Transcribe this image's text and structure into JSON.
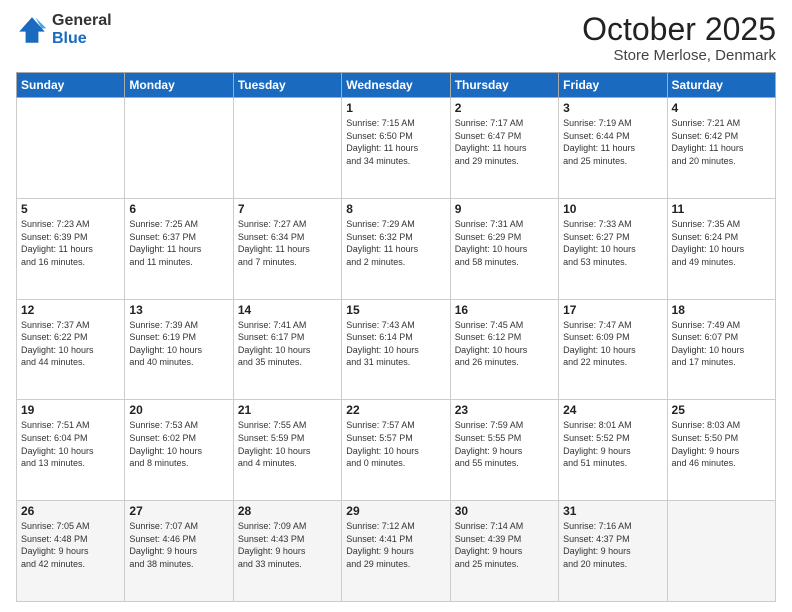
{
  "logo": {
    "general": "General",
    "blue": "Blue"
  },
  "header": {
    "month": "October 2025",
    "location": "Store Merlose, Denmark"
  },
  "weekdays": [
    "Sunday",
    "Monday",
    "Tuesday",
    "Wednesday",
    "Thursday",
    "Friday",
    "Saturday"
  ],
  "weeks": [
    [
      {
        "day": "",
        "info": ""
      },
      {
        "day": "",
        "info": ""
      },
      {
        "day": "",
        "info": ""
      },
      {
        "day": "1",
        "info": "Sunrise: 7:15 AM\nSunset: 6:50 PM\nDaylight: 11 hours\nand 34 minutes."
      },
      {
        "day": "2",
        "info": "Sunrise: 7:17 AM\nSunset: 6:47 PM\nDaylight: 11 hours\nand 29 minutes."
      },
      {
        "day": "3",
        "info": "Sunrise: 7:19 AM\nSunset: 6:44 PM\nDaylight: 11 hours\nand 25 minutes."
      },
      {
        "day": "4",
        "info": "Sunrise: 7:21 AM\nSunset: 6:42 PM\nDaylight: 11 hours\nand 20 minutes."
      }
    ],
    [
      {
        "day": "5",
        "info": "Sunrise: 7:23 AM\nSunset: 6:39 PM\nDaylight: 11 hours\nand 16 minutes."
      },
      {
        "day": "6",
        "info": "Sunrise: 7:25 AM\nSunset: 6:37 PM\nDaylight: 11 hours\nand 11 minutes."
      },
      {
        "day": "7",
        "info": "Sunrise: 7:27 AM\nSunset: 6:34 PM\nDaylight: 11 hours\nand 7 minutes."
      },
      {
        "day": "8",
        "info": "Sunrise: 7:29 AM\nSunset: 6:32 PM\nDaylight: 11 hours\nand 2 minutes."
      },
      {
        "day": "9",
        "info": "Sunrise: 7:31 AM\nSunset: 6:29 PM\nDaylight: 10 hours\nand 58 minutes."
      },
      {
        "day": "10",
        "info": "Sunrise: 7:33 AM\nSunset: 6:27 PM\nDaylight: 10 hours\nand 53 minutes."
      },
      {
        "day": "11",
        "info": "Sunrise: 7:35 AM\nSunset: 6:24 PM\nDaylight: 10 hours\nand 49 minutes."
      }
    ],
    [
      {
        "day": "12",
        "info": "Sunrise: 7:37 AM\nSunset: 6:22 PM\nDaylight: 10 hours\nand 44 minutes."
      },
      {
        "day": "13",
        "info": "Sunrise: 7:39 AM\nSunset: 6:19 PM\nDaylight: 10 hours\nand 40 minutes."
      },
      {
        "day": "14",
        "info": "Sunrise: 7:41 AM\nSunset: 6:17 PM\nDaylight: 10 hours\nand 35 minutes."
      },
      {
        "day": "15",
        "info": "Sunrise: 7:43 AM\nSunset: 6:14 PM\nDaylight: 10 hours\nand 31 minutes."
      },
      {
        "day": "16",
        "info": "Sunrise: 7:45 AM\nSunset: 6:12 PM\nDaylight: 10 hours\nand 26 minutes."
      },
      {
        "day": "17",
        "info": "Sunrise: 7:47 AM\nSunset: 6:09 PM\nDaylight: 10 hours\nand 22 minutes."
      },
      {
        "day": "18",
        "info": "Sunrise: 7:49 AM\nSunset: 6:07 PM\nDaylight: 10 hours\nand 17 minutes."
      }
    ],
    [
      {
        "day": "19",
        "info": "Sunrise: 7:51 AM\nSunset: 6:04 PM\nDaylight: 10 hours\nand 13 minutes."
      },
      {
        "day": "20",
        "info": "Sunrise: 7:53 AM\nSunset: 6:02 PM\nDaylight: 10 hours\nand 8 minutes."
      },
      {
        "day": "21",
        "info": "Sunrise: 7:55 AM\nSunset: 5:59 PM\nDaylight: 10 hours\nand 4 minutes."
      },
      {
        "day": "22",
        "info": "Sunrise: 7:57 AM\nSunset: 5:57 PM\nDaylight: 10 hours\nand 0 minutes."
      },
      {
        "day": "23",
        "info": "Sunrise: 7:59 AM\nSunset: 5:55 PM\nDaylight: 9 hours\nand 55 minutes."
      },
      {
        "day": "24",
        "info": "Sunrise: 8:01 AM\nSunset: 5:52 PM\nDaylight: 9 hours\nand 51 minutes."
      },
      {
        "day": "25",
        "info": "Sunrise: 8:03 AM\nSunset: 5:50 PM\nDaylight: 9 hours\nand 46 minutes."
      }
    ],
    [
      {
        "day": "26",
        "info": "Sunrise: 7:05 AM\nSunset: 4:48 PM\nDaylight: 9 hours\nand 42 minutes."
      },
      {
        "day": "27",
        "info": "Sunrise: 7:07 AM\nSunset: 4:46 PM\nDaylight: 9 hours\nand 38 minutes."
      },
      {
        "day": "28",
        "info": "Sunrise: 7:09 AM\nSunset: 4:43 PM\nDaylight: 9 hours\nand 33 minutes."
      },
      {
        "day": "29",
        "info": "Sunrise: 7:12 AM\nSunset: 4:41 PM\nDaylight: 9 hours\nand 29 minutes."
      },
      {
        "day": "30",
        "info": "Sunrise: 7:14 AM\nSunset: 4:39 PM\nDaylight: 9 hours\nand 25 minutes."
      },
      {
        "day": "31",
        "info": "Sunrise: 7:16 AM\nSunset: 4:37 PM\nDaylight: 9 hours\nand 20 minutes."
      },
      {
        "day": "",
        "info": ""
      }
    ]
  ]
}
